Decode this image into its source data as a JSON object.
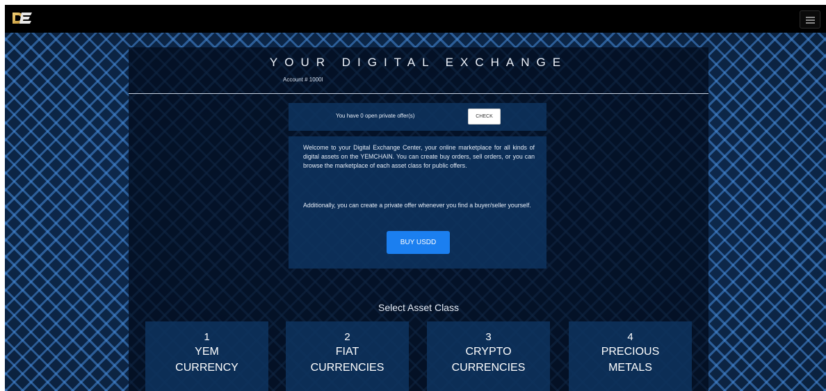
{
  "header": {
    "title": "YOUR DIGITAL EXCHANGE",
    "account": "Account # 1000l"
  },
  "offers": {
    "text": "You have 0 open private offer(s)",
    "check_label": "CHECK"
  },
  "welcome": {
    "paragraph1": "Welcome to your Digital Exchange Center, your online marketplace for all kinds of digital assets on the YEMCHAIN. You can create buy orders, sell orders, or you can browse the marketplace of each asset class for public offers.",
    "paragraph2": "Additionally, you can create a private offer whenever you find a buyer/seller yourself.",
    "buy_label": "BUY USDD"
  },
  "assets": {
    "title": "Select Asset Class",
    "classes": [
      {
        "number": "1",
        "line1": "YEM",
        "line2": "CURRENCY"
      },
      {
        "number": "2",
        "line1": "FIAT",
        "line2": "CURRENCIES"
      },
      {
        "number": "3",
        "line1": "CRYPTO",
        "line2": "CURRENCIES"
      },
      {
        "number": "4",
        "line1": "PRECIOUS",
        "line2": "METALS"
      }
    ]
  },
  "icons": {
    "logo": "de-logo",
    "menu": "hamburger-menu-icon"
  },
  "colors": {
    "navbar": "#000000",
    "accent_button": "#1b7ff0",
    "panel": "#030c1e",
    "card": "#0e345f"
  }
}
